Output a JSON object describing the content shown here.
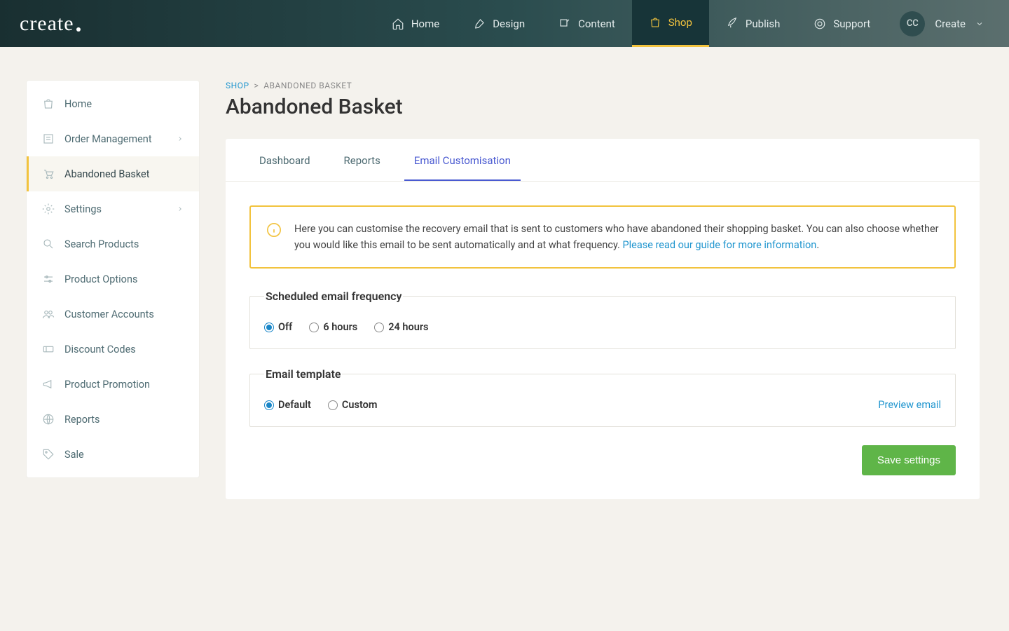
{
  "brand": "create",
  "topnav": [
    {
      "label": "Home",
      "icon": "home"
    },
    {
      "label": "Design",
      "icon": "brush"
    },
    {
      "label": "Content",
      "icon": "edit"
    },
    {
      "label": "Shop",
      "icon": "bag",
      "active": true
    },
    {
      "label": "Publish",
      "icon": "rocket"
    },
    {
      "label": "Support",
      "icon": "life"
    }
  ],
  "user": {
    "initials": "CC",
    "name": "Create"
  },
  "sidebar": [
    {
      "label": "Home",
      "icon": "bag"
    },
    {
      "label": "Order Management",
      "icon": "orders",
      "chevron": true
    },
    {
      "label": "Abandoned Basket",
      "icon": "cart",
      "active": true
    },
    {
      "label": "Settings",
      "icon": "gear",
      "chevron": true
    },
    {
      "label": "Search Products",
      "icon": "search"
    },
    {
      "label": "Product Options",
      "icon": "sliders"
    },
    {
      "label": "Customer Accounts",
      "icon": "people"
    },
    {
      "label": "Discount Codes",
      "icon": "ticket"
    },
    {
      "label": "Product Promotion",
      "icon": "megaphone"
    },
    {
      "label": "Reports",
      "icon": "globe"
    },
    {
      "label": "Sale",
      "icon": "tag"
    }
  ],
  "breadcrumb": {
    "root": "SHOP",
    "sep": ">",
    "current": "ABANDONED BASKET"
  },
  "page_title": "Abandoned Basket",
  "tabs": [
    {
      "label": "Dashboard"
    },
    {
      "label": "Reports"
    },
    {
      "label": "Email Customisation",
      "active": true
    }
  ],
  "alert": {
    "text": "Here you can customise the recovery email that is sent to customers who have abandoned their shopping basket. You can also choose whether you would like this email to be sent automatically and at what frequency. ",
    "link_text": "Please read our guide for more information",
    "trail": "."
  },
  "frequency": {
    "legend": "Scheduled email frequency",
    "options": [
      {
        "label": "Off",
        "checked": true
      },
      {
        "label": "6 hours",
        "checked": false
      },
      {
        "label": "24 hours",
        "checked": false
      }
    ]
  },
  "template": {
    "legend": "Email template",
    "options": [
      {
        "label": "Default",
        "checked": true
      },
      {
        "label": "Custom",
        "checked": false
      }
    ],
    "preview_label": "Preview email"
  },
  "save_label": "Save settings"
}
